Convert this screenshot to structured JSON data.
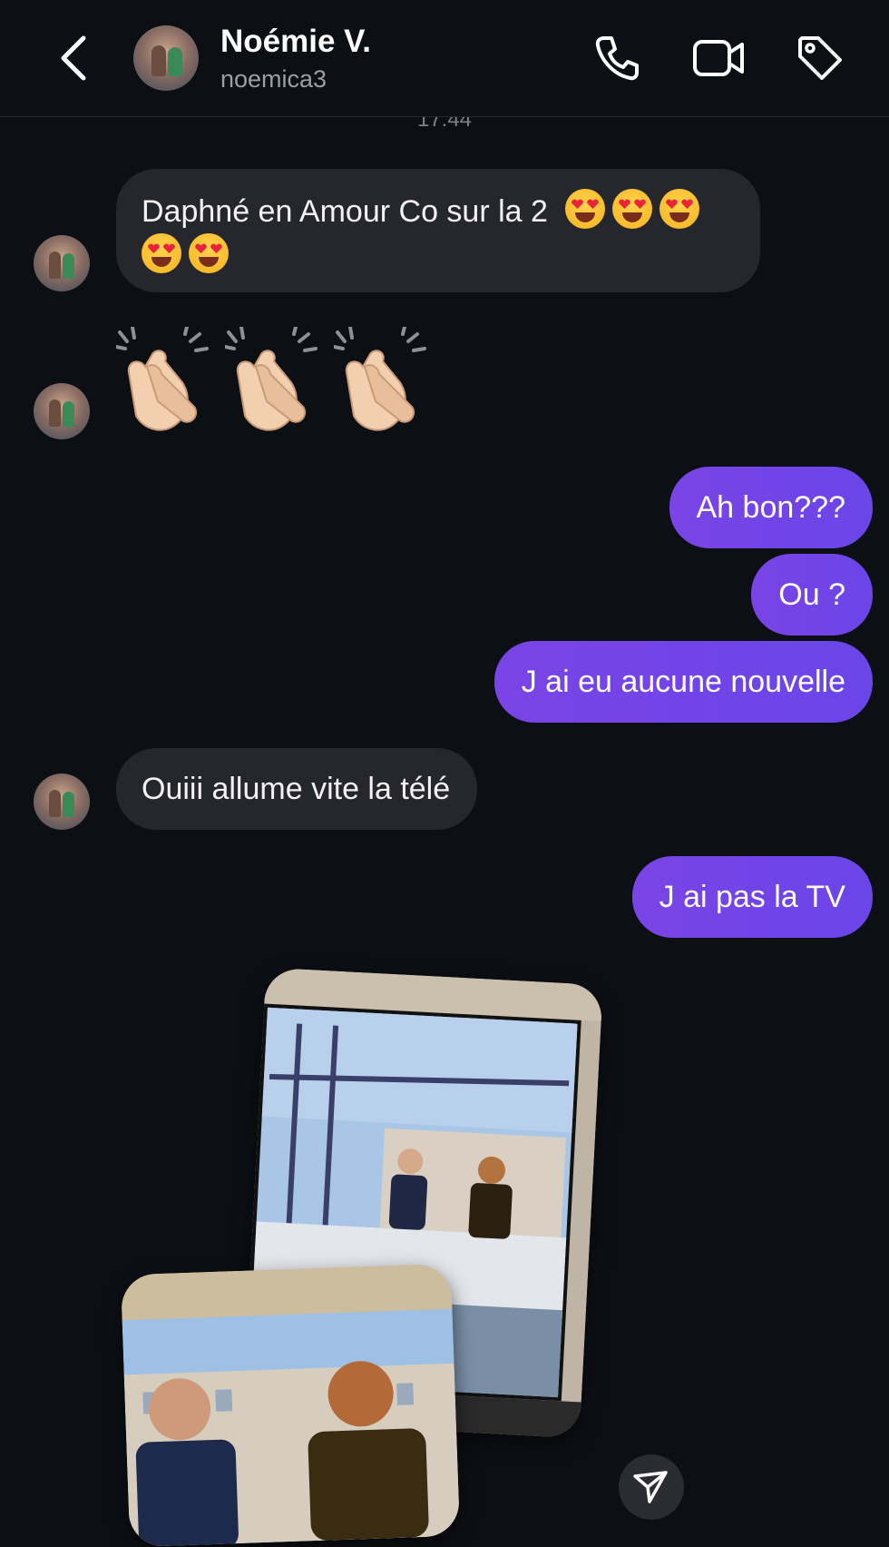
{
  "header": {
    "name": "Noémie V.",
    "handle": "noemica3",
    "back_icon": "chevron-left-icon",
    "call_icon": "phone-icon",
    "video_icon": "video-camera-icon",
    "tag_icon": "tag-icon"
  },
  "timestamp": "17:44",
  "messages": [
    {
      "sender": "contact",
      "text": "Daphné en Amour Co sur la 2",
      "emoji": "heart-eyes-face x5"
    },
    {
      "sender": "contact",
      "emoji": "clapping-hands x3"
    },
    {
      "sender": "me",
      "text": "Ah bon???"
    },
    {
      "sender": "me",
      "text": "Ou ?"
    },
    {
      "sender": "me",
      "text": "J ai eu aucune nouvelle"
    },
    {
      "sender": "contact",
      "text": "Ouiii allume vite la télé"
    },
    {
      "sender": "me",
      "text": "J ai pas la TV"
    },
    {
      "sender": "contact",
      "attachment": "photos of TV screen x2"
    }
  ],
  "colors": {
    "background": "#0c0f14",
    "incoming_bubble": "#25272d",
    "outgoing_bubble": "#7a44e6"
  },
  "footer": {
    "send_icon": "paper-plane-icon"
  }
}
